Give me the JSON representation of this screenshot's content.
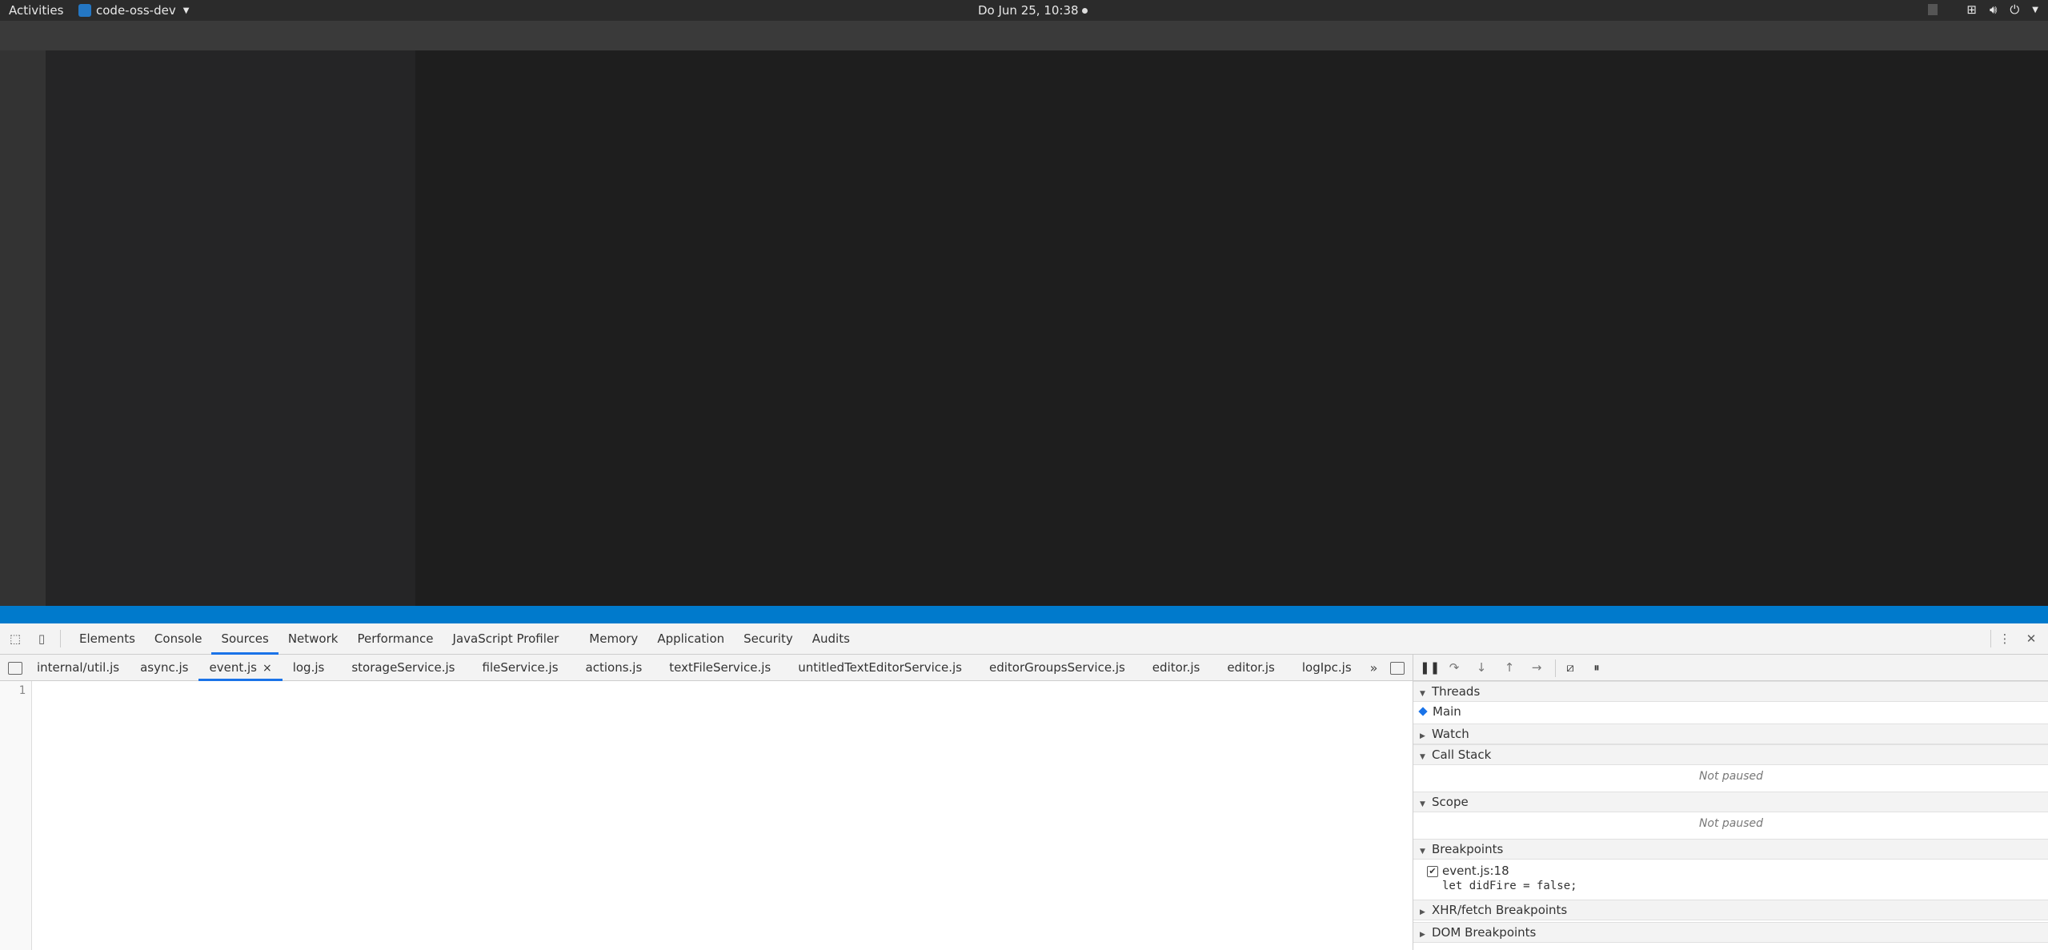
{
  "topbar": {
    "activities": "Activities",
    "app_name": "code-oss-dev",
    "clock": "Do Jun 25, 10:38"
  },
  "devtools": {
    "tabs": [
      "Elements",
      "Console",
      "Sources",
      "Network",
      "Performance",
      "JavaScript Profiler",
      "Memory",
      "Application",
      "Security",
      "Audits"
    ],
    "active_tab": "Sources",
    "file_tabs": [
      "internal/util.js",
      "async.js",
      "event.js",
      "log.js",
      "storageService.js",
      "fileService.js",
      "actions.js",
      "textFileService.js",
      "untitledTextEditorService.js",
      "editorGroupsService.js",
      "editor.js",
      "editor.js",
      "logIpc.js"
    ],
    "active_file": "event.js",
    "more_tabs": "»",
    "line_number": "1",
    "debugger": {
      "threads": {
        "title": "Threads",
        "items": [
          "Main"
        ]
      },
      "watch": {
        "title": "Watch"
      },
      "call_stack": {
        "title": "Call Stack",
        "status": "Not paused"
      },
      "scope": {
        "title": "Scope",
        "status": "Not paused"
      },
      "breakpoints": {
        "title": "Breakpoints",
        "items": [
          {
            "location": "event.js:18",
            "code": "let didFire = false;"
          }
        ]
      },
      "xhr": {
        "title": "XHR/fetch Breakpoints"
      },
      "dom": {
        "title": "DOM Breakpoints"
      }
    }
  }
}
